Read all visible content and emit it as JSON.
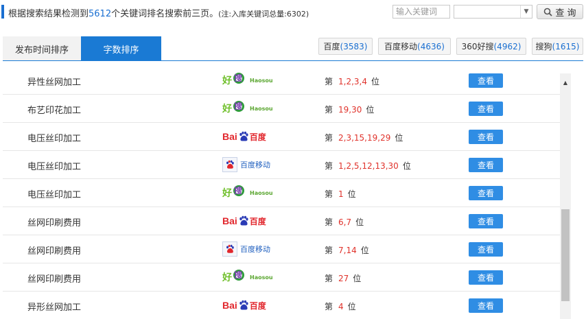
{
  "summary": {
    "prefix": "根据搜索结果检测到",
    "count": "5612",
    "suffix": "个关键词排名搜索前三页。",
    "note": "(注:入库关键词总量:6302)"
  },
  "search": {
    "placeholder": "输入关键词",
    "select_value": "",
    "query_label": "查 询"
  },
  "tabs": [
    {
      "label": "发布时间排序"
    },
    {
      "label": "字数排序"
    }
  ],
  "engines": [
    {
      "name": "百度",
      "count": "(3583)"
    },
    {
      "name": "百度移动",
      "count": "(4636)"
    },
    {
      "name": "360好搜",
      "count": "(4962)"
    },
    {
      "name": "搜狗",
      "count": "(1615)"
    }
  ],
  "rank_prefix": "第",
  "rank_suffix": "位",
  "view_label": "查看",
  "logos": {
    "haosou": {
      "hao": "好",
      "sou": "搜",
      "text": "Haosou"
    },
    "baidu": {
      "bai": "Bai",
      "du": "百度"
    },
    "baidu_mobile": {
      "text": "百度移动"
    }
  },
  "rows": [
    {
      "keyword": "异性丝网加工",
      "engine": "haosou",
      "positions": "1,2,3,4"
    },
    {
      "keyword": "布艺印花加工",
      "engine": "haosou",
      "positions": "19,30"
    },
    {
      "keyword": "电压丝印加工",
      "engine": "baidu",
      "positions": "2,3,15,19,29"
    },
    {
      "keyword": "电压丝印加工",
      "engine": "baidu_mobile",
      "positions": "1,2,5,12,13,30"
    },
    {
      "keyword": "电压丝印加工",
      "engine": "haosou",
      "positions": "1"
    },
    {
      "keyword": "丝网印刷费用",
      "engine": "baidu",
      "positions": "6,7"
    },
    {
      "keyword": "丝网印刷费用",
      "engine": "baidu_mobile",
      "positions": "7,14"
    },
    {
      "keyword": "丝网印刷费用",
      "engine": "haosou",
      "positions": "27"
    },
    {
      "keyword": "异形丝网加工",
      "engine": "baidu",
      "positions": "4"
    }
  ],
  "colors": {
    "accent": "#1a6fd1",
    "tab_active": "#1a7ad4",
    "view_button": "#2f8de4",
    "rank_position": "#e0322b"
  }
}
